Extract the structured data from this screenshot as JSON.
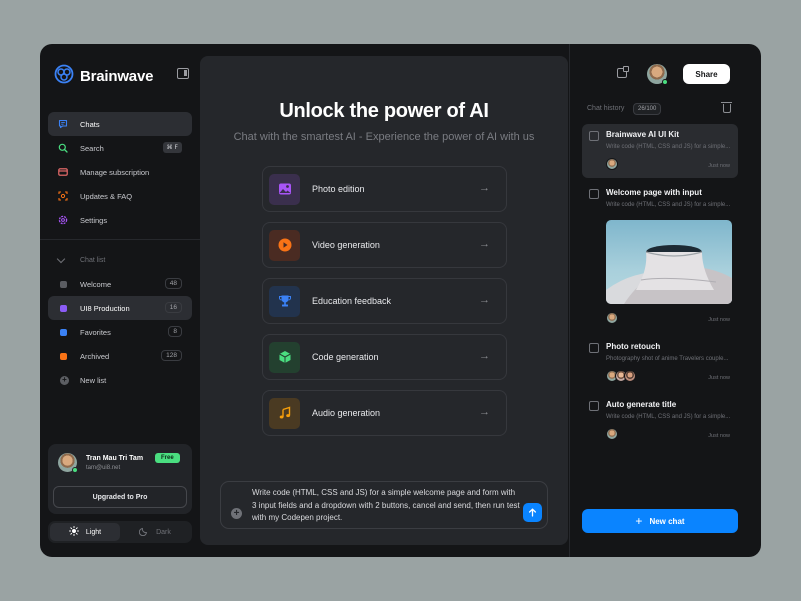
{
  "app": {
    "name": "Brainwave",
    "accent": "#0a84ff"
  },
  "nav": {
    "items": [
      {
        "label": "Chats",
        "icon": "chat-bubble-icon",
        "color": "#3b82f6"
      },
      {
        "label": "Search",
        "icon": "search-icon",
        "color": "#4ade80",
        "shortcut": "⌘ F"
      },
      {
        "label": "Manage subscription",
        "icon": "credit-card-icon",
        "color": "#f87171"
      },
      {
        "label": "Updates & FAQ",
        "icon": "scan-icon",
        "color": "#f97316"
      },
      {
        "label": "Settings",
        "icon": "gear-icon",
        "color": "#a855f7"
      }
    ]
  },
  "chat_list": {
    "title": "Chat list",
    "items": [
      {
        "label": "Welcome",
        "count": "48",
        "color": "#5b5d62"
      },
      {
        "label": "UI8 Production",
        "count": "16",
        "color": "#8b5cf6"
      },
      {
        "label": "Favorites",
        "count": "8",
        "color": "#3b82f6"
      },
      {
        "label": "Archived",
        "count": "128",
        "color": "#f97316"
      }
    ],
    "new_list": "New list"
  },
  "user": {
    "name": "Tran Mau Tri Tam",
    "email": "tam@ui8.net",
    "plan_badge": "Free",
    "upgrade_label": "Upgraded to Pro"
  },
  "theme": {
    "light": "Light",
    "dark": "Dark",
    "selected": "Light"
  },
  "main": {
    "title": "Unlock the power of AI",
    "subtitle": "Chat with the smartest AI - Experience the power of AI with us",
    "features": [
      {
        "label": "Photo edition",
        "icon": "image-icon",
        "color": "#a855f7"
      },
      {
        "label": "Video generation",
        "icon": "play-icon",
        "color": "#f97316"
      },
      {
        "label": "Education feedback",
        "icon": "trophy-icon",
        "color": "#3b82f6"
      },
      {
        "label": "Code generation",
        "icon": "cube-icon",
        "color": "#4ade80"
      },
      {
        "label": "Audio generation",
        "icon": "music-note-icon",
        "color": "#f59e0b"
      }
    ],
    "composer_text": "Write code (HTML, CSS and JS) for a simple welcome page and form with 3 input fields and a dropdown with 2 buttons, cancel and send, then run test with my Codepen project."
  },
  "right_panel": {
    "share_label": "Share",
    "history_label": "Chat history",
    "history_count": "26/100",
    "history": [
      {
        "title": "Brainwave AI UI Kit",
        "desc": "Write code (HTML, CSS and JS) for a simple...",
        "time": "Just now"
      },
      {
        "title": "Welcome page with input",
        "desc": "Write code (HTML, CSS and JS) for a simple...",
        "time": "Just now"
      },
      {
        "title": "Photo retouch",
        "desc": "Photography shot of anime Travelers couple...",
        "time": "Just now"
      },
      {
        "title": "Auto generate title",
        "desc": "Write code (HTML, CSS and JS) for a simple...",
        "time": "Just now"
      }
    ],
    "new_chat_label": "New chat"
  }
}
